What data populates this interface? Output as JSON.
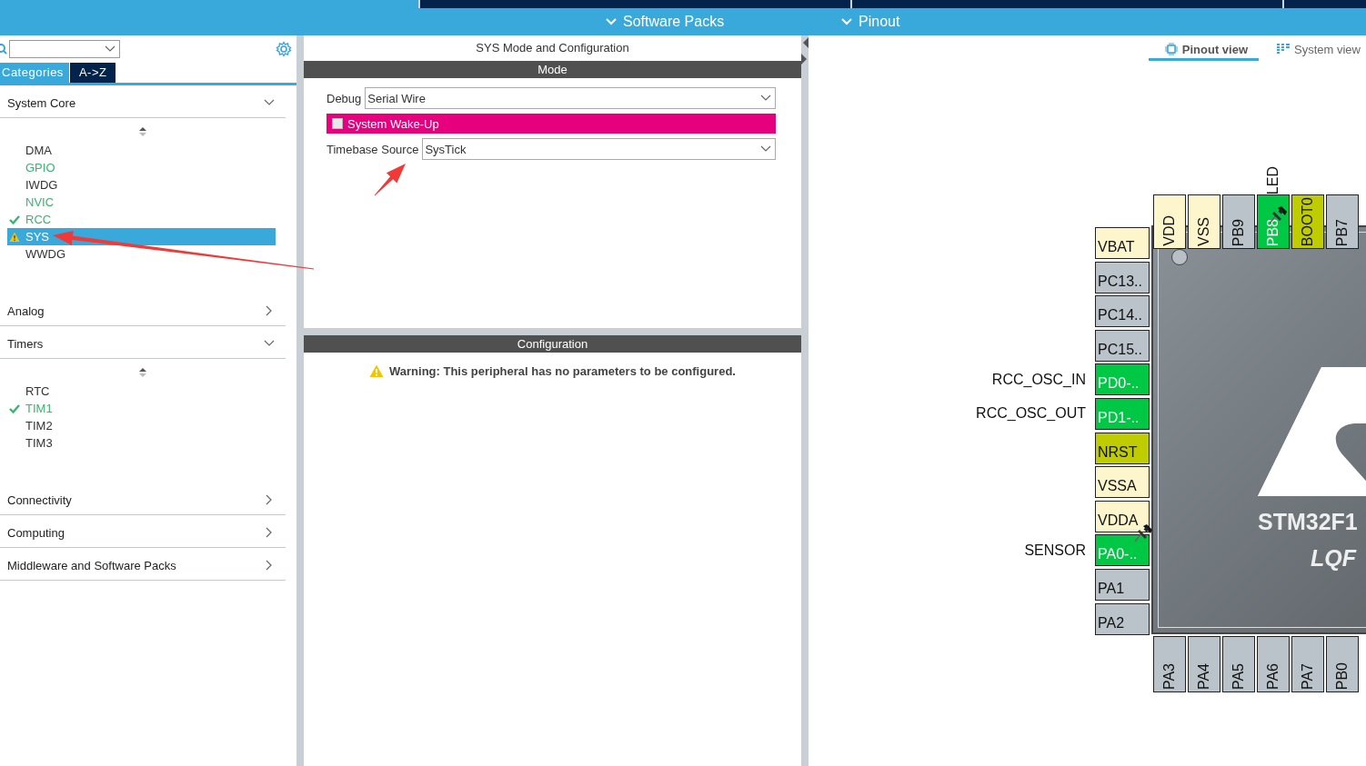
{
  "top_tabs": [
    {
      "selected": true
    },
    {
      "selected": false
    },
    {
      "selected": false
    }
  ],
  "sub_menus": [
    {
      "label": "Software Packs"
    },
    {
      "label": "Pinout"
    }
  ],
  "left_panel": {
    "view_tabs": [
      {
        "label": "Categories",
        "selected": true
      },
      {
        "label": "A->Z",
        "selected": false
      }
    ],
    "categories": [
      {
        "name": "System Core",
        "expanded": true,
        "items": [
          {
            "label": "DMA",
            "kind": "plain",
            "selected": false
          },
          {
            "label": "GPIO",
            "kind": "configured",
            "selected": false
          },
          {
            "label": "IWDG",
            "kind": "plain",
            "selected": false
          },
          {
            "label": "NVIC",
            "kind": "configured",
            "selected": false
          },
          {
            "label": "RCC",
            "kind": "ok",
            "selected": false
          },
          {
            "label": "SYS",
            "kind": "warning",
            "selected": true
          },
          {
            "label": "WWDG",
            "kind": "plain",
            "selected": false
          }
        ]
      },
      {
        "name": "Analog",
        "expanded": false
      },
      {
        "name": "Timers",
        "expanded": true,
        "items": [
          {
            "label": "RTC",
            "kind": "plain",
            "selected": false
          },
          {
            "label": "TIM1",
            "kind": "ok",
            "selected": false
          },
          {
            "label": "TIM2",
            "kind": "plain",
            "selected": false
          },
          {
            "label": "TIM3",
            "kind": "plain",
            "selected": false
          }
        ]
      },
      {
        "name": "Connectivity",
        "expanded": false
      },
      {
        "name": "Computing",
        "expanded": false
      },
      {
        "name": "Middleware and Software Packs",
        "expanded": false
      }
    ]
  },
  "mode_panel": {
    "title": "SYS Mode and Configuration",
    "mode_header": "Mode",
    "fields": [
      {
        "kind": "select",
        "label": "Debug",
        "value": "Serial Wire"
      },
      {
        "kind": "checkbox",
        "label": "System Wake-Up",
        "checked": false
      },
      {
        "kind": "select",
        "label": "Timebase Source",
        "value": "SysTick"
      }
    ],
    "configuration_header": "Configuration",
    "warning": "Warning: This peripheral has no parameters to be configured."
  },
  "pinout": {
    "view_tabs": [
      {
        "label": "Pinout view",
        "selected": true
      },
      {
        "label": "System view",
        "selected": false
      }
    ],
    "chip": {
      "name": "STM32F1",
      "package": "LQF"
    },
    "top_pins": [
      {
        "name": "VDD",
        "kind": "power"
      },
      {
        "name": "VSS",
        "kind": "power"
      },
      {
        "name": "PB9",
        "kind": "gpio"
      },
      {
        "name": "PB8",
        "kind": "assigned",
        "signal": "LED",
        "pinned": true
      },
      {
        "name": "BOOT0",
        "kind": "reset"
      },
      {
        "name": "PB7",
        "kind": "gpio"
      }
    ],
    "left_pins": [
      {
        "name": "VBAT",
        "kind": "power"
      },
      {
        "name": "PC13..",
        "kind": "gpio"
      },
      {
        "name": "PC14..",
        "kind": "gpio"
      },
      {
        "name": "PC15..",
        "kind": "gpio"
      },
      {
        "name": "PD0-..",
        "kind": "assigned",
        "signal": "RCC_OSC_IN"
      },
      {
        "name": "PD1-..",
        "kind": "assigned",
        "signal": "RCC_OSC_OUT"
      },
      {
        "name": "NRST",
        "kind": "reset"
      },
      {
        "name": "VSSA",
        "kind": "power"
      },
      {
        "name": "VDDA",
        "kind": "power"
      },
      {
        "name": "PA0-..",
        "kind": "assigned",
        "signal": "SENSOR",
        "pinned": true
      },
      {
        "name": "PA1",
        "kind": "gpio"
      },
      {
        "name": "PA2",
        "kind": "gpio"
      }
    ],
    "bottom_pins": [
      {
        "name": "PA3",
        "kind": "gpio"
      },
      {
        "name": "PA4",
        "kind": "gpio"
      },
      {
        "name": "PA5",
        "kind": "gpio"
      },
      {
        "name": "PA6",
        "kind": "gpio"
      },
      {
        "name": "PA7",
        "kind": "gpio"
      },
      {
        "name": "PB0",
        "kind": "gpio"
      }
    ]
  },
  "annotations": [
    {
      "kind": "arrow"
    },
    {
      "kind": "arrow"
    }
  ]
}
